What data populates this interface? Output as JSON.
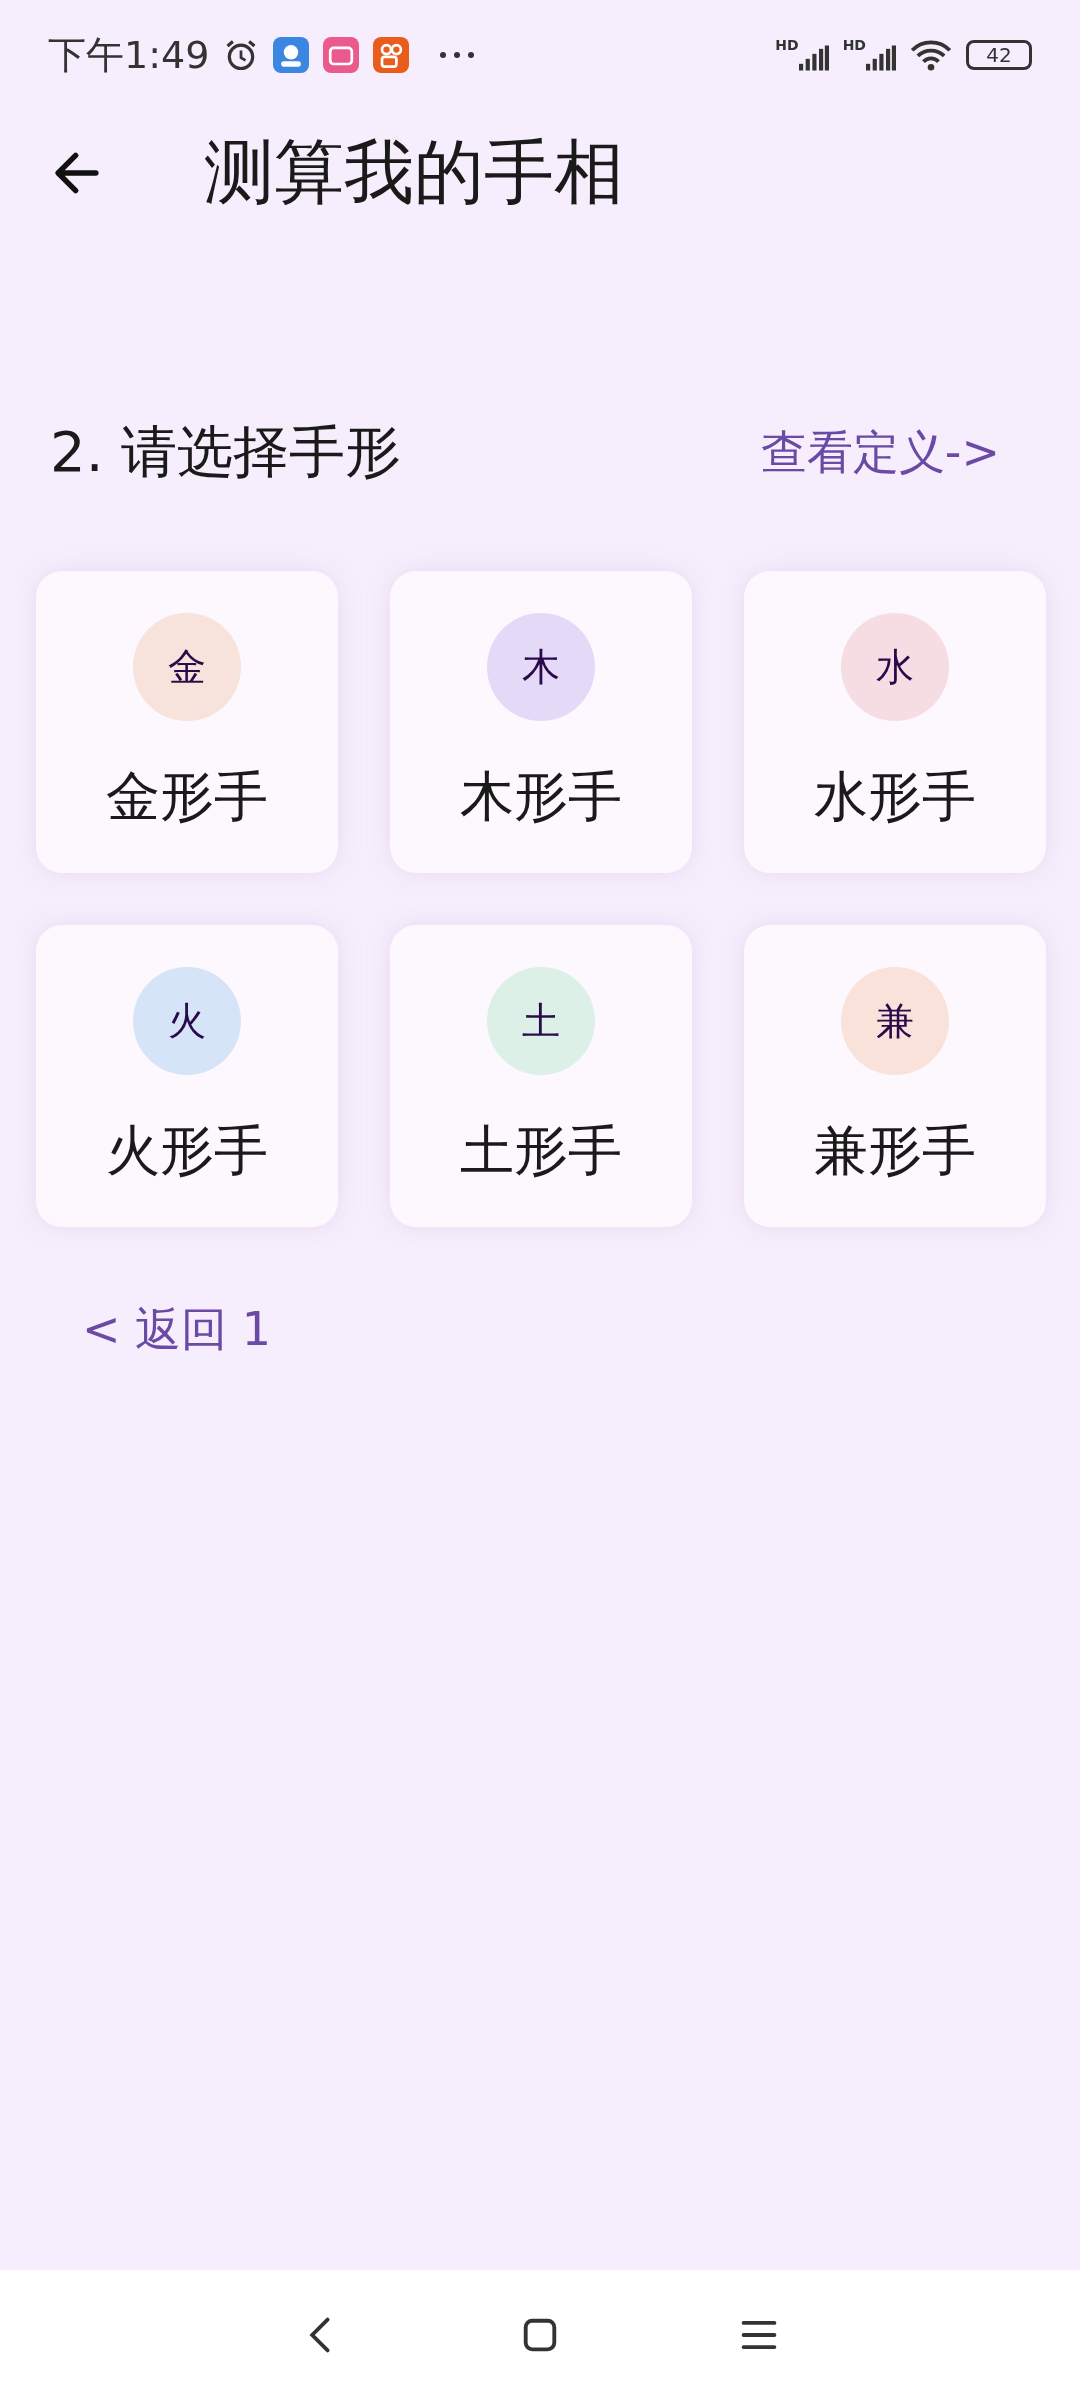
{
  "status_bar": {
    "time": "下午1:49",
    "signals": [
      {
        "label": "HD"
      },
      {
        "label": "HD"
      }
    ],
    "battery": "42"
  },
  "header": {
    "title": "测算我的手相"
  },
  "section": {
    "heading": "2. 请选择手形",
    "link": "查看定义->"
  },
  "options": [
    {
      "badge": "金",
      "label": "金形手",
      "color": "#f7e3dc"
    },
    {
      "badge": "木",
      "label": "木形手",
      "color": "#e5d9f8"
    },
    {
      "badge": "水",
      "label": "水形手",
      "color": "#f6dde3"
    },
    {
      "badge": "火",
      "label": "火形手",
      "color": "#d6e4f8"
    },
    {
      "badge": "土",
      "label": "土形手",
      "color": "#dcf0e8"
    },
    {
      "badge": "兼",
      "label": "兼形手",
      "color": "#f8e2da"
    }
  ],
  "back_link": "< 返回 1"
}
